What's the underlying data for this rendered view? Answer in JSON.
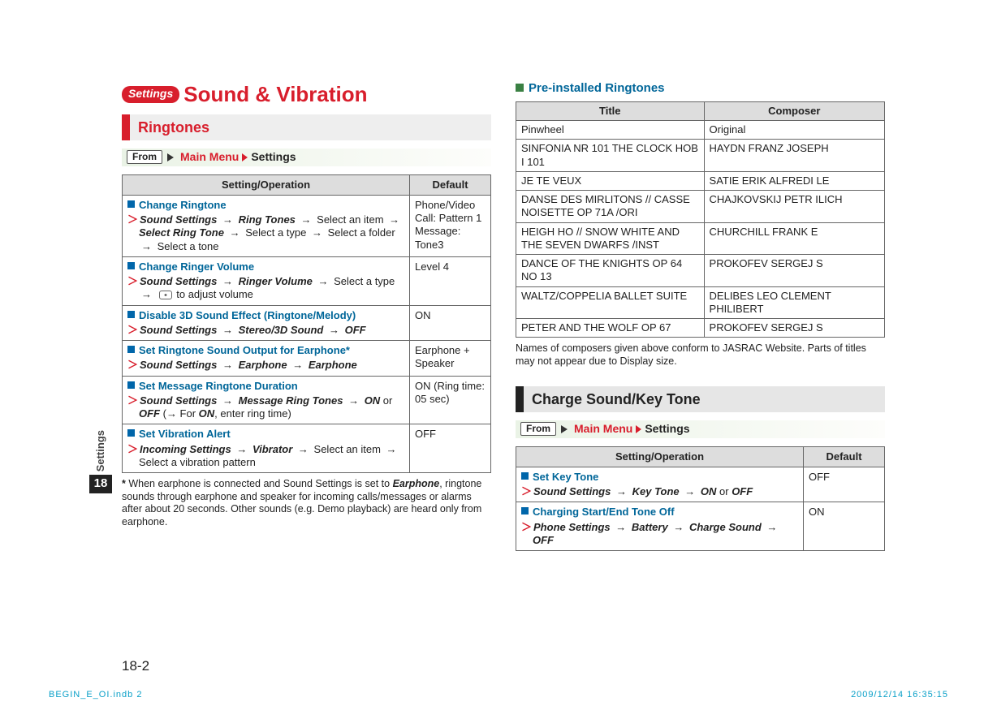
{
  "meta": {
    "side_tab_label": "Settings",
    "side_tab_number": "18",
    "page_number": "18-2",
    "imprint_left": "BEGIN_E_OI.indb   2",
    "imprint_right": "2009/12/14   16:35:15"
  },
  "left": {
    "chip": "Settings",
    "h1": "Sound & Vibration",
    "subhead": "Ringtones",
    "from": {
      "badge": "From",
      "menu": "Main Menu",
      "tail": "Settings"
    },
    "table": {
      "head_op": "Setting/Operation",
      "head_def": "Default",
      "rows": [
        {
          "title": "Change Ringtone",
          "proc": "<span class='bi'>Sound Settings</span> <span class='arr'>→</span> <span class='bi'>Ring Tones</span> <span class='arr'>→</span> Select an item <span class='arr'>→</span> <span class='bi'>Select Ring Tone</span> <span class='arr'>→</span> Select a type <span class='arr'>→</span> Select a folder <span class='arr'>→</span> Select a tone",
          "def": "Phone/Video Call: Pattern 1<br>Message: Tone3"
        },
        {
          "title": "Change Ringer Volume",
          "proc": "<span class='bi'>Sound Settings</span> <span class='arr'>→</span> <span class='bi'>Ringer Volume</span> <span class='arr'>→</span> Select a type <span class='arr'>→</span> <span class='nav-icon' data-name='nav-key-icon' data-interactable='false'></span> to adjust volume",
          "def": "Level 4"
        },
        {
          "title": "Disable 3D Sound Effect (Ringtone/Melody)",
          "proc": "<span class='bi'>Sound Settings</span> <span class='arr'>→</span> <span class='bi'>Stereo/3D Sound</span> <span class='arr'>→</span> <span class='bi'>OFF</span>",
          "def": "ON"
        },
        {
          "title": "Set Ringtone Sound Output for Earphone*",
          "proc": "<span class='bi'>Sound Settings</span> <span class='arr'>→</span> <span class='bi'>Earphone</span> <span class='arr'>→</span> <span class='bi'>Earphone</span>",
          "def": "Earphone + Speaker"
        },
        {
          "title": "Set Message Ringtone Duration",
          "proc": "<span class='bi'>Sound Settings</span> <span class='arr'>→</span> <span class='bi'>Message Ring Tones</span> <span class='arr'>→</span> <span class='bi'>ON</span> or <span class='bi'>OFF</span> (→ For <span class='bi'>ON</span>, enter ring time)",
          "def": "ON (Ring time: 05 sec)"
        },
        {
          "title": "Set Vibration Alert",
          "proc": "<span class='bi'>Incoming Settings</span> <span class='arr'>→</span> <span class='bi'>Vibrator</span> <span class='arr'>→</span> Select an item <span class='arr'>→</span> Select a vibration pattern",
          "def": "OFF"
        }
      ]
    },
    "footnote_star": "*",
    "footnote": "When earphone is connected and Sound Settings is set to <b><i>Earphone</i></b>, ringtone sounds through earphone and speaker for incoming calls/messages or alarms after about 20 seconds. Other sounds (e.g. Demo playback) are heard only from earphone."
  },
  "right": {
    "ringtones_head": "Pre-installed Ringtones",
    "composer_table": {
      "head_title": "Title",
      "head_comp": "Composer",
      "rows": [
        {
          "t": "Pinwheel",
          "c": "Original"
        },
        {
          "t": "SINFONIA NR 101 THE CLOCK HOB I 101",
          "c": "HAYDN FRANZ JOSEPH"
        },
        {
          "t": "JE TE VEUX",
          "c": "SATIE ERIK ALFREDI LE"
        },
        {
          "t": "DANSE DES MIRLITONS // CASSE NOISETTE OP 71A /ORI",
          "c": "CHAJKOVSKIJ PETR ILICH"
        },
        {
          "t": "HEIGH HO // SNOW WHITE AND THE SEVEN DWARFS /INST",
          "c": "CHURCHILL FRANK E"
        },
        {
          "t": "DANCE OF THE KNIGHTS OP 64 NO 13",
          "c": "PROKOFEV SERGEJ S"
        },
        {
          "t": "WALTZ/COPPELIA BALLET SUITE",
          "c": "DELIBES LEO CLEMENT PHILIBERT"
        },
        {
          "t": "PETER AND THE WOLF OP 67",
          "c": "PROKOFEV SERGEJ S"
        }
      ]
    },
    "composer_note": "Names of composers given above conform to JASRAC Website. Parts of titles may not appear due to Display size.",
    "subhead2": "Charge Sound/Key Tone",
    "from2": {
      "badge": "From",
      "menu": "Main Menu",
      "tail": "Settings"
    },
    "table2": {
      "head_op": "Setting/Operation",
      "head_def": "Default",
      "rows": [
        {
          "title": "Set Key Tone",
          "proc": "<span class='bi'>Sound Settings</span> <span class='arr'>→</span> <span class='bi'>Key Tone</span> <span class='arr'>→</span> <span class='bi'>ON</span> or <span class='bi'>OFF</span>",
          "def": "OFF"
        },
        {
          "title": "Charging Start/End Tone Off",
          "proc": "<span class='bi'>Phone Settings</span> <span class='arr'>→</span> <span class='bi'>Battery</span> <span class='arr'>→</span> <span class='bi'>Charge Sound</span> <span class='arr'>→</span> <span class='bi'>OFF</span>",
          "def": "ON"
        }
      ]
    }
  }
}
